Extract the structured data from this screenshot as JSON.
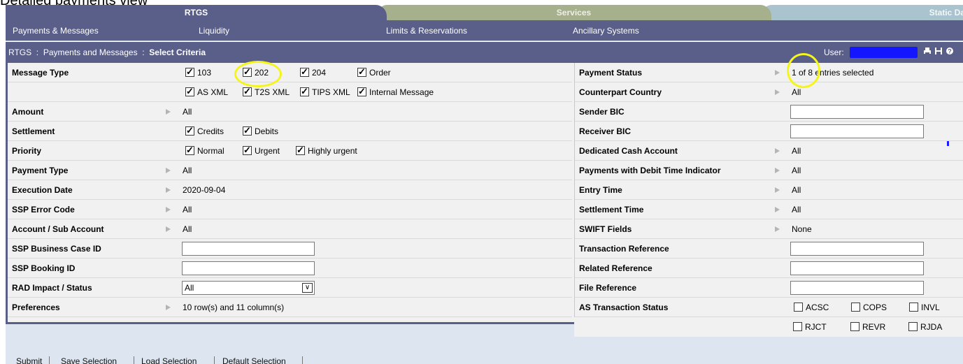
{
  "caption": "Detailed payments view",
  "tabs": {
    "rtgs": "RTGS",
    "services": "Services",
    "static_data": "Static Da"
  },
  "subnav": [
    "Payments & Messages",
    "Liquidity",
    "Limits & Reservations",
    "Ancillary Systems"
  ],
  "breadcrumb": {
    "part1": "RTGS",
    "sep": ":",
    "part2": "Payments and Messages",
    "part3": "Select Criteria"
  },
  "user_label": "User:",
  "icons": [
    "print-icon",
    "save-icon",
    "help-icon"
  ],
  "left": {
    "message_type": {
      "label": "Message Type",
      "options": [
        {
          "label": "103",
          "checked": true
        },
        {
          "label": "202",
          "checked": true
        },
        {
          "label": "204",
          "checked": true
        },
        {
          "label": "Order",
          "checked": true
        },
        {
          "label": "AS XML",
          "checked": true
        },
        {
          "label": "T2S XML",
          "checked": true
        },
        {
          "label": "TIPS XML",
          "checked": true
        },
        {
          "label": "Internal Message",
          "checked": true
        }
      ]
    },
    "amount": {
      "label": "Amount",
      "value": "All"
    },
    "settlement": {
      "label": "Settlement",
      "options": [
        {
          "label": "Credits",
          "checked": true
        },
        {
          "label": "Debits",
          "checked": true
        }
      ]
    },
    "priority": {
      "label": "Priority",
      "options": [
        {
          "label": "Normal",
          "checked": true
        },
        {
          "label": "Urgent",
          "checked": true
        },
        {
          "label": "Highly urgent",
          "checked": true
        }
      ]
    },
    "payment_type": {
      "label": "Payment Type",
      "value": "All"
    },
    "execution_date": {
      "label": "Execution Date",
      "value": "2020-09-04"
    },
    "ssp_error_code": {
      "label": "SSP Error Code",
      "value": "All"
    },
    "account_sub_account": {
      "label": "Account / Sub Account",
      "value": "All"
    },
    "ssp_business_case_id": {
      "label": "SSP Business Case ID",
      "value": ""
    },
    "ssp_booking_id": {
      "label": "SSP Booking ID",
      "value": ""
    },
    "rad_impact_status": {
      "label": "RAD Impact / Status",
      "value": "All"
    },
    "preferences": {
      "label": "Preferences",
      "value": "10 row(s) and 11 column(s)"
    }
  },
  "right": {
    "payment_status": {
      "label": "Payment Status",
      "value": "1 of 8 entries selected"
    },
    "counterpart_country": {
      "label": "Counterpart Country",
      "value": "All"
    },
    "sender_bic": {
      "label": "Sender BIC",
      "value": ""
    },
    "receiver_bic": {
      "label": "Receiver BIC",
      "value": ""
    },
    "dedicated_cash_account": {
      "label": "Dedicated Cash Account",
      "value": "All"
    },
    "payments_debit_time": {
      "label": "Payments with Debit Time Indicator",
      "value": "All"
    },
    "entry_time": {
      "label": "Entry Time",
      "value": "All"
    },
    "settlement_time": {
      "label": "Settlement Time",
      "value": "All"
    },
    "swift_fields": {
      "label": "SWIFT Fields",
      "value": "None"
    },
    "transaction_reference": {
      "label": "Transaction Reference",
      "value": ""
    },
    "related_reference": {
      "label": "Related Reference",
      "value": ""
    },
    "file_reference": {
      "label": "File Reference",
      "value": ""
    },
    "as_transaction_status": {
      "label": "AS Transaction Status",
      "options": [
        {
          "label": "ACSC",
          "checked": false
        },
        {
          "label": "COPS",
          "checked": false
        },
        {
          "label": "INVL",
          "checked": false
        },
        {
          "label": "RJCT",
          "checked": false
        },
        {
          "label": "REVR",
          "checked": false
        },
        {
          "label": "RJDA",
          "checked": false
        }
      ]
    }
  },
  "footer": [
    "Submit",
    "Save Selection",
    "Load Selection",
    "Default Selection"
  ],
  "colors": {
    "header": "#5a5f8a",
    "services_tab": "#a6b08c",
    "static_tab": "#a9c3cf",
    "highlight_circle": "#f5f51a",
    "redaction": "#1416ff"
  }
}
